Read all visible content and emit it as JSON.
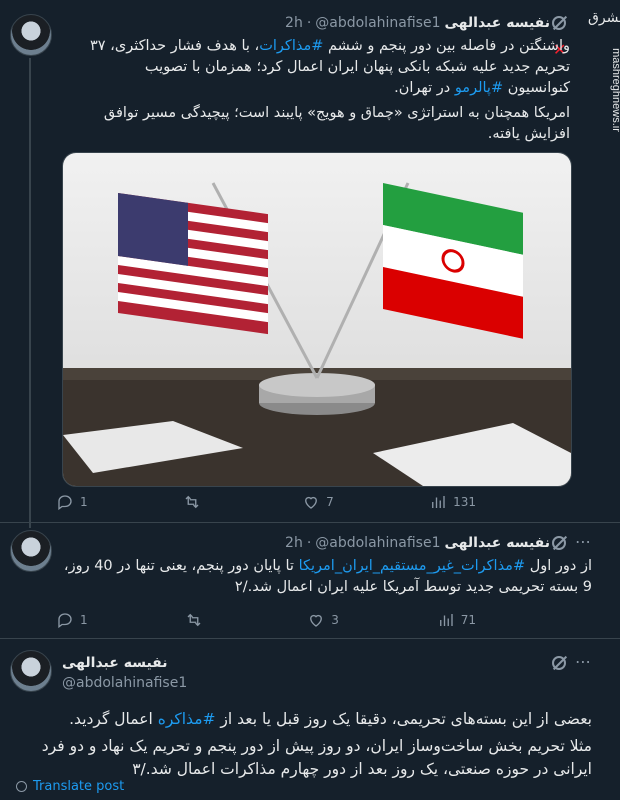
{
  "tweets": [
    {
      "name": "نفیسه عبدالهی",
      "handle": "@abdolahinafise1",
      "dot": "·",
      "time": "2h",
      "paragraphs": [
        {
          "parts": [
            {
              "t": "واشنگتن در فاصله بین دور پنجم و ششم ",
              "link": false
            },
            {
              "t": "#مذاکرات",
              "link": true
            },
            {
              "t": "، با هدف فشار حداکثری، ۳۷ تحریم جدید علیه شبکه بانکی پنهان ایران اعمال کرد؛ همزمان با تصویب کنوانسیون ",
              "link": false
            },
            {
              "t": "#پالرمو",
              "link": true
            },
            {
              "t": " در تهران.",
              "link": false
            }
          ]
        },
        {
          "parts": [
            {
              "t": "امریکا همچنان به استراتژی «چماق و هویج» پایبند است؛ پیچیدگی مسیر توافق افزایش یافته.",
              "link": false
            }
          ]
        }
      ],
      "actions": {
        "reply": "1",
        "retweet": "",
        "like": "7",
        "views": "131"
      }
    },
    {
      "name": "نفیسه عبدالهی",
      "handle": "@abdolahinafise1",
      "dot": "·",
      "time": "2h",
      "paragraphs": [
        {
          "parts": [
            {
              "t": "از دور اول ",
              "link": false
            },
            {
              "t": "#مذاکرات_غیر_مستقیم_ایران_امریکا",
              "link": true
            },
            {
              "t": " تا پایان دور پنجم، یعنی تنها در 40 روز، 9 بسته تحریمی جدید توسط آمریکا علیه ایران اعمال شد./۲",
              "link": false
            }
          ]
        }
      ],
      "actions": {
        "reply": "1",
        "retweet": "",
        "like": "3",
        "views": "71"
      }
    },
    {
      "name": "نفیسه عبدالهی",
      "handle": "@abdolahinafise1",
      "paragraphs": [
        {
          "parts": [
            {
              "t": "بعضی از این بسته‌های تحریمی، دقیقا یک روز قبل یا بعد از ",
              "link": false
            },
            {
              "t": "#مذاکره",
              "link": true
            },
            {
              "t": " اعمال گردید.",
              "link": false
            }
          ]
        },
        {
          "parts": [
            {
              "t": "مثلا تحریم بخش ساخت‌وساز ایران، دو روز پیش از دور پنجم و تحریم یک نهاد و دو فرد ایرانی در حوزه صنعتی، یک روز بعد از دور چهارم مذاکرات اعمال شد./۳",
              "link": false
            }
          ]
        }
      ]
    }
  ],
  "translate_label": "Translate post",
  "watermark": {
    "logo": "مشرق",
    "site": "mashreghnews.ir"
  },
  "colors": {
    "background": "#15202b",
    "text": "#e7e9ea",
    "muted": "#8b98a5",
    "link": "#1d9bf0",
    "border": "#38444d",
    "x_mark": "#f4212e"
  }
}
